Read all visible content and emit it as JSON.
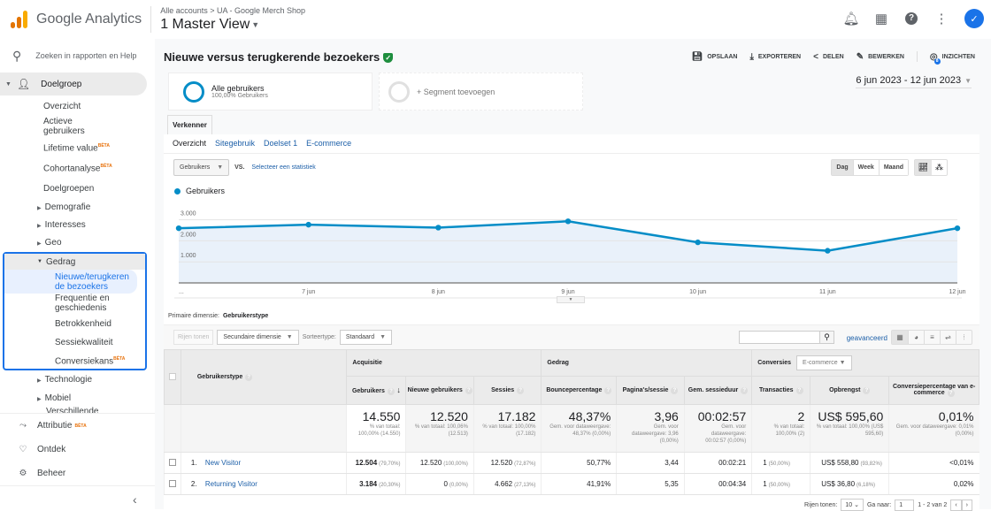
{
  "header": {
    "brand": "Google Analytics",
    "breadcrumb": "Alle accounts > UA - Google Merch Shop",
    "view": "1 Master View",
    "logo_colors": [
      "#f9ab00",
      "#e37400",
      "#e37400"
    ],
    "icons": [
      "bell-icon",
      "apps-grid-icon",
      "help-icon",
      "more-vert-icon",
      "account-avatar"
    ]
  },
  "sidebar": {
    "search_placeholder": "Zoeken in rapporten en Help",
    "section": "Doelgroep",
    "items": [
      {
        "label": "Overzicht"
      },
      {
        "label": "Actieve gebruikers"
      },
      {
        "label": "Lifetime value",
        "badge": "BÈTA"
      },
      {
        "label": "Cohortanalyse",
        "badge": "BÈTA"
      },
      {
        "label": "Doelgroepen"
      }
    ],
    "groups": [
      "Demografie",
      "Interesses",
      "Geo"
    ],
    "gedrag": {
      "label": "Gedrag",
      "items": [
        {
          "label": "Nieuwe/terugkerende bezoekers",
          "active": true
        },
        {
          "label": "Frequentie en geschiedenis"
        },
        {
          "label": "Betrokkenheid"
        },
        {
          "label": "Sessiekwaliteit"
        },
        {
          "label": "Conversiekans",
          "badge": "BÈTA"
        }
      ]
    },
    "groups_after": [
      "Technologie",
      "Mobiel",
      "Verschillende"
    ],
    "bottom": [
      {
        "label": "Attributie",
        "badge": "BÈTA",
        "icon": "attribution-icon"
      },
      {
        "label": "Ontdek",
        "icon": "lightbulb-icon"
      },
      {
        "label": "Beheer",
        "icon": "gear-icon"
      }
    ]
  },
  "report": {
    "title": "Nieuwe versus terugkerende bezoekers",
    "actions": [
      "OPSLAAN",
      "EXPORTEREN",
      "DELEN",
      "BEWERKEN",
      "INZICHTEN"
    ],
    "insights_count": "8",
    "segment": {
      "name": "Alle gebruikers",
      "sub": "100,00% Gebruikers",
      "add": "+ Segment toevoegen"
    },
    "date_range": "6 jun 2023 - 12 jun 2023",
    "tab": "Verkenner",
    "subtabs": [
      "Overzicht",
      "Sitegebruik",
      "Doelset 1",
      "E-commerce"
    ],
    "metric_select": "Gebruikers",
    "vs": "VS.",
    "select_metric": "Selecteer een statistiek",
    "periods": [
      "Dag",
      "Week",
      "Maand"
    ],
    "primary_dim_label": "Primaire dimensie:",
    "primary_dim": "Gebruikerstype"
  },
  "chart_data": {
    "type": "area",
    "series": [
      {
        "name": "Gebruikers",
        "color": "#058dc7",
        "values": [
          2600,
          2770,
          2630,
          2930,
          1930,
          1530,
          2600
        ]
      }
    ],
    "x": [
      "6 jun",
      "7 jun",
      "8 jun",
      "9 jun",
      "10 jun",
      "11 jun",
      "12 jun"
    ],
    "x_tick_labels": [
      "...",
      "7 jun",
      "8 jun",
      "9 jun",
      "10 jun",
      "11 jun",
      "12 jun"
    ],
    "y_ticks": [
      "1.000",
      "2.000",
      "3.000"
    ],
    "ylim": [
      0,
      3700
    ],
    "legend": "top-left",
    "grid": true
  },
  "table": {
    "toolbar": {
      "rows_btn": "Rijen tonen",
      "secondary": "Secundaire dimensie",
      "sort_label": "Sorteertype:",
      "sort": "Standaard",
      "advanced": "geavanceerd"
    },
    "dim_header": "Gebruikerstype",
    "groups": [
      "Acquisitie",
      "Gedrag",
      "Conversies"
    ],
    "conv_select": "E-commerce",
    "columns": [
      "Gebruikers",
      "Nieuwe gebruikers",
      "Sessies",
      "Bouncepercentage",
      "Pagina's/sessie",
      "Gem. sessieduur",
      "Transacties",
      "Opbrengst",
      "Conversiepercentage van e-commerce"
    ],
    "totals": [
      {
        "v": "14.550",
        "s": "% van totaal: 100,00% (14.550)"
      },
      {
        "v": "12.520",
        "s": "% van totaal: 100,06% (12.513)"
      },
      {
        "v": "17.182",
        "s": "% van totaal: 100,00% (17.182)"
      },
      {
        "v": "48,37%",
        "s": "Gem. voor dataweergave: 48,37% (0,00%)"
      },
      {
        "v": "3,96",
        "s": "Gem. voor dataweergave: 3,96 (0,00%)"
      },
      {
        "v": "00:02:57",
        "s": "Gem. voor dataweergave: 00:02:57 (0,00%)"
      },
      {
        "v": "2",
        "s": "% van totaal: 100,00% (2)"
      },
      {
        "v": "US$ 595,60",
        "s": "% van totaal: 100,00% (US$ 595,60)"
      },
      {
        "v": "0,01%",
        "s": "Gem. voor dataweergave: 0,01% (0,00%)"
      }
    ],
    "rows": [
      {
        "n": "1.",
        "name": "New Visitor",
        "cells": [
          [
            "12.504",
            "(79,70%)"
          ],
          [
            "12.520",
            "(100,00%)"
          ],
          [
            "12.520",
            "(72,87%)"
          ],
          [
            "50,77%",
            ""
          ],
          [
            "3,44",
            ""
          ],
          [
            "00:02:21",
            ""
          ],
          [
            "1",
            "(50,00%)"
          ],
          [
            "US$ 558,80",
            "(93,82%)"
          ],
          [
            "<0,01%",
            ""
          ]
        ]
      },
      {
        "n": "2.",
        "name": "Returning Visitor",
        "cells": [
          [
            "3.184",
            "(20,30%)"
          ],
          [
            "0",
            "(0,00%)"
          ],
          [
            "4.662",
            "(27,13%)"
          ],
          [
            "41,91%",
            ""
          ],
          [
            "5,35",
            ""
          ],
          [
            "00:04:34",
            ""
          ],
          [
            "1",
            "(50,00%)"
          ],
          [
            "US$ 36,80",
            "(6,18%)"
          ],
          [
            "0,02%",
            ""
          ]
        ]
      }
    ],
    "pager": {
      "rows_label": "Rijen tonen:",
      "rows": "10",
      "goto_label": "Ga naar:",
      "goto": "1",
      "range": "1 - 2 van 2"
    }
  }
}
